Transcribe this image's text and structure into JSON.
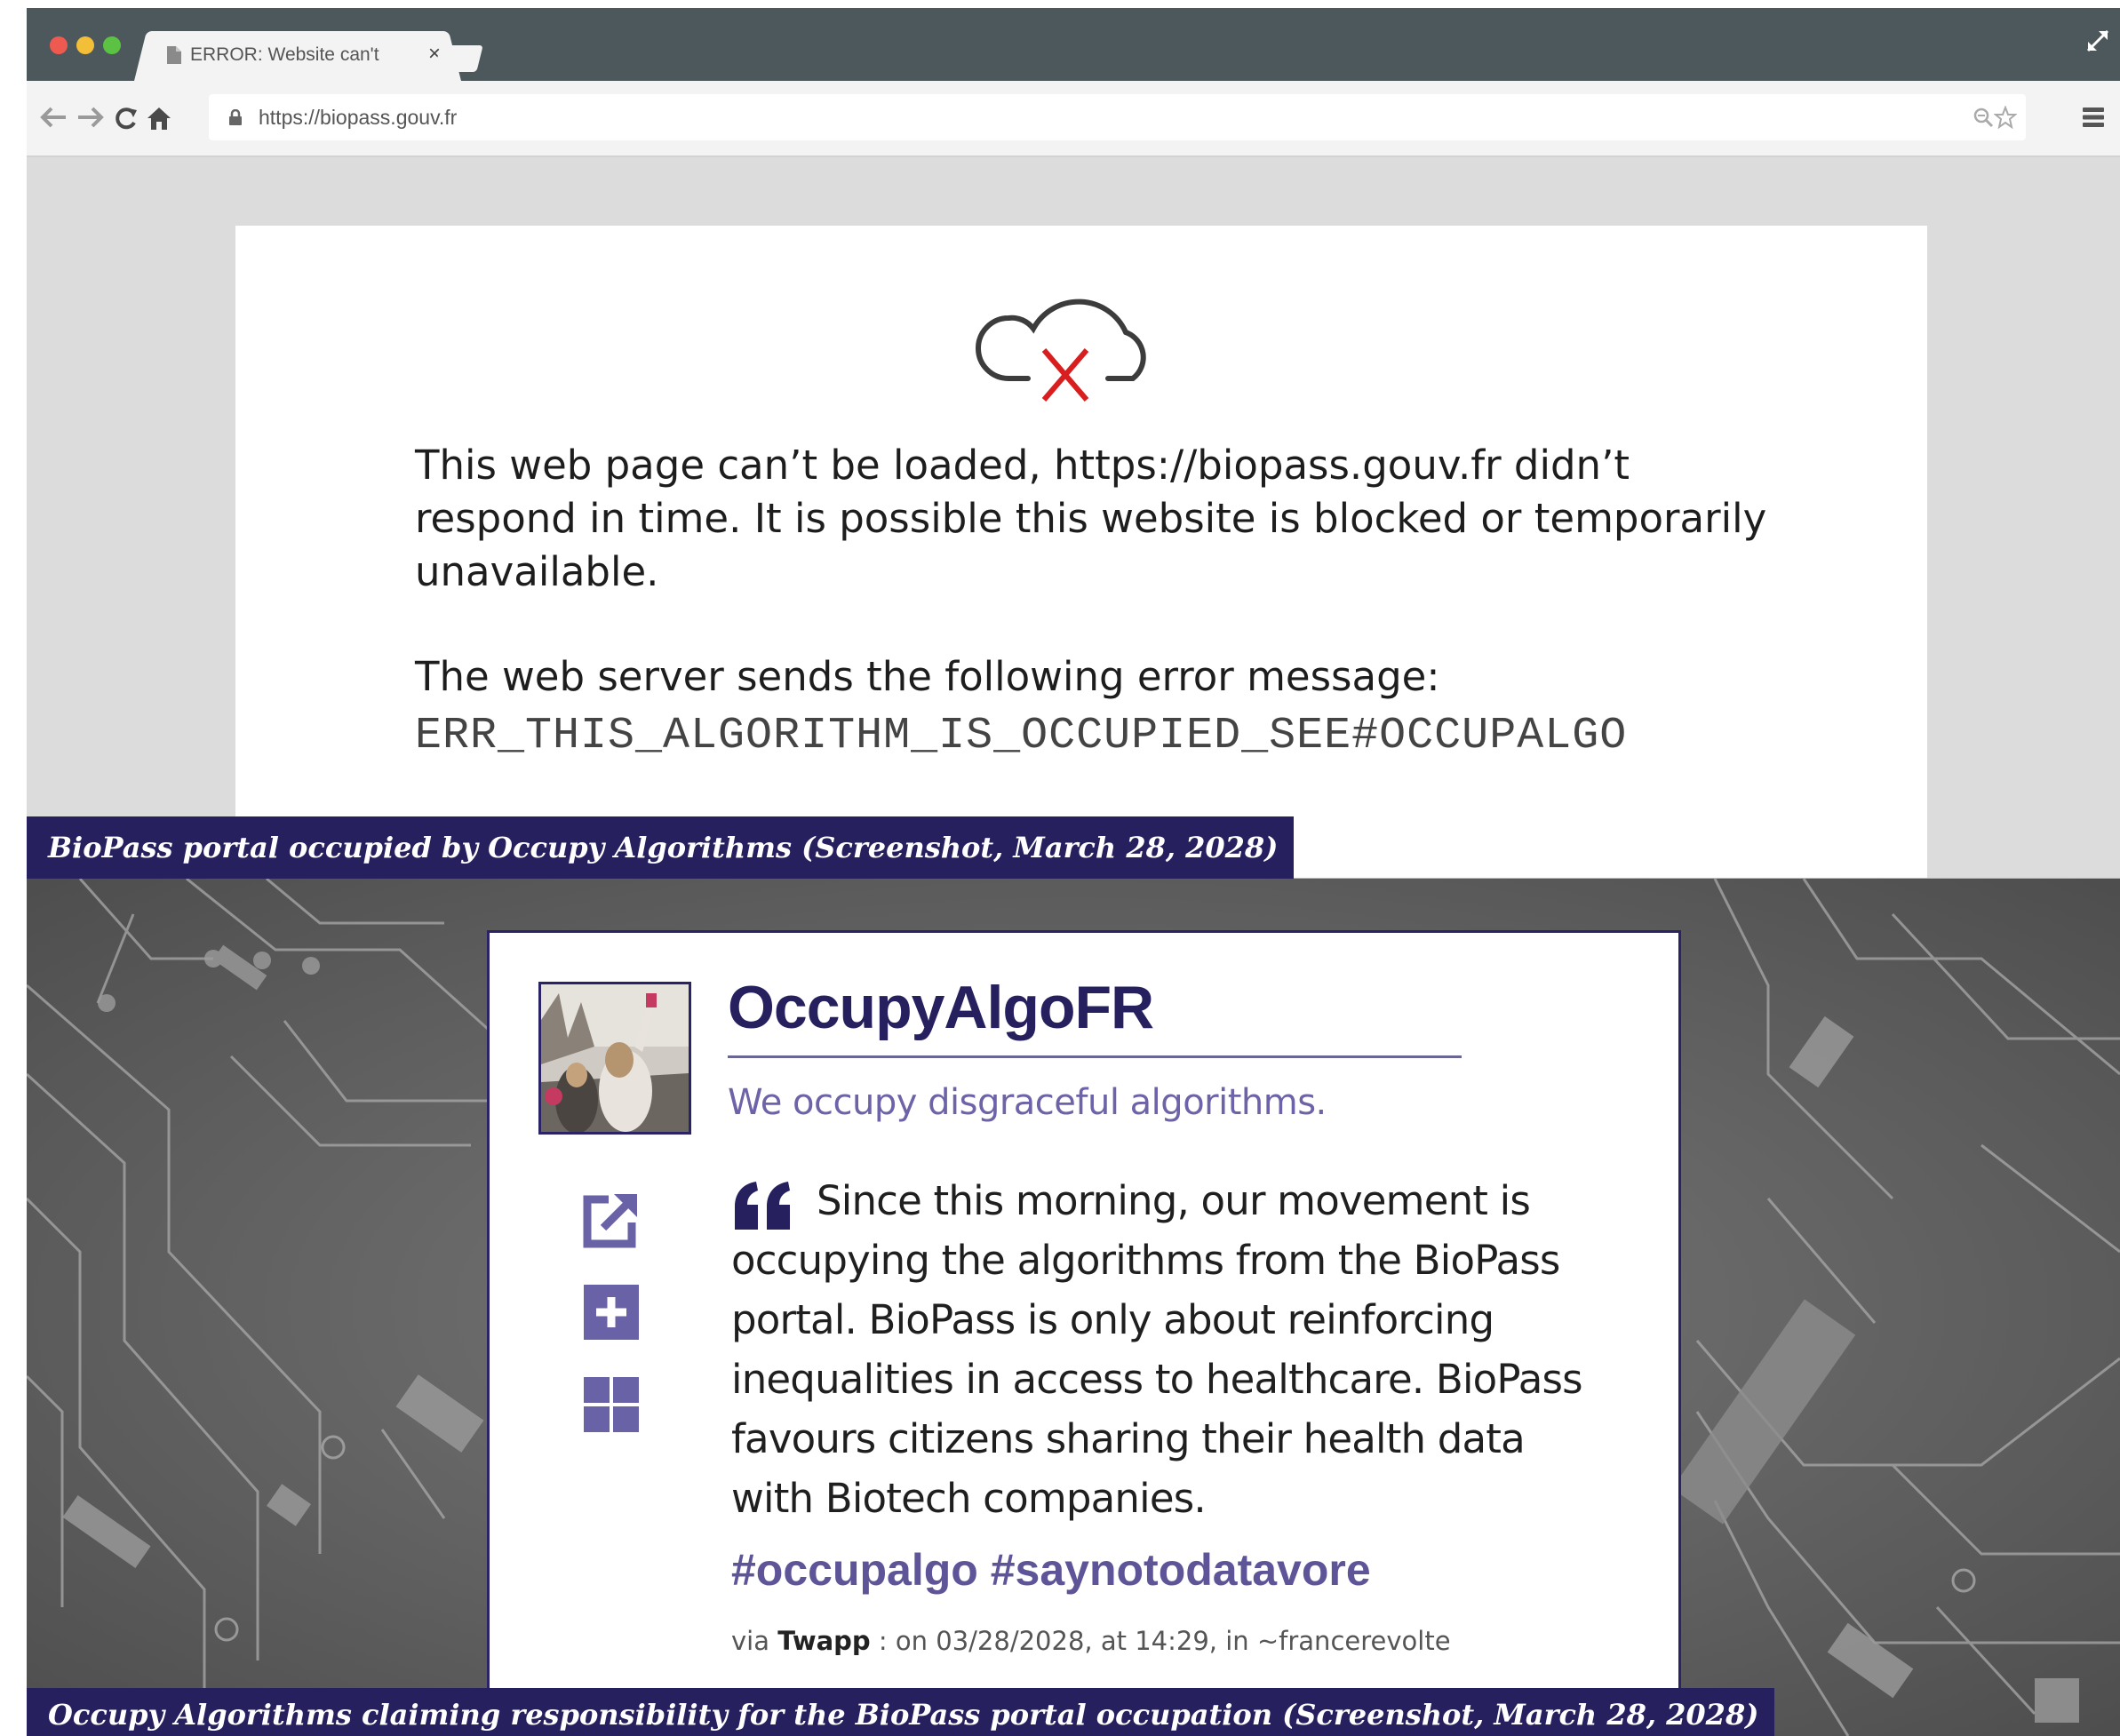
{
  "browser": {
    "tab_title": "ERROR: Website can't",
    "tab_close": "×",
    "url": "https://biopass.gouv.fr"
  },
  "error_page": {
    "message": "This web page can’t be loaded, https://biopass.gouv.fr didn’t respond in time. It is possible this website is blocked or temporarily unavailable.",
    "server_message_label": "The web server sends the following error message:",
    "error_code": "ERR_THIS_ALGORITHM_IS_OCCUPIED_SEE#OCCUPALGO"
  },
  "captions": {
    "top": "BioPass portal occupied by Occupy Algorithms (Screenshot, March 28, 2028)",
    "bottom": "Occupy Algorithms claiming responsibility for the BioPass portal occupation (Screenshot, March 28, 2028)"
  },
  "post": {
    "account_name": "OccupyAlgoFR",
    "tagline": "We occupy disgraceful algorithms.",
    "text": "Since this morning, our movement is occupying the algorithms from the BioPass portal. BioPass is only about reinforcing inequalities in access to healthcare. BioPass favours citizens sharing their health data with Biotech companies.",
    "hashtags": "#occupalgo #saynotodatavore",
    "meta_via": "via",
    "meta_app": "Twapp",
    "meta_rest": ": on 03/28/2028, at 14:29, in ~francerevolte"
  },
  "colors": {
    "brand_purple": "#26205f",
    "accent_purple": "#6c63a8",
    "error_red": "#d81e1e",
    "titlebar": "#4d585c"
  },
  "icons": [
    "document-icon",
    "expand-icon",
    "back-icon",
    "forward-icon",
    "reload-icon",
    "home-icon",
    "lock-icon",
    "zoom-icon",
    "star-icon",
    "menu-icon",
    "cloud-error-icon",
    "external-link-icon",
    "plus-icon",
    "grid-icon",
    "quote-icon"
  ]
}
